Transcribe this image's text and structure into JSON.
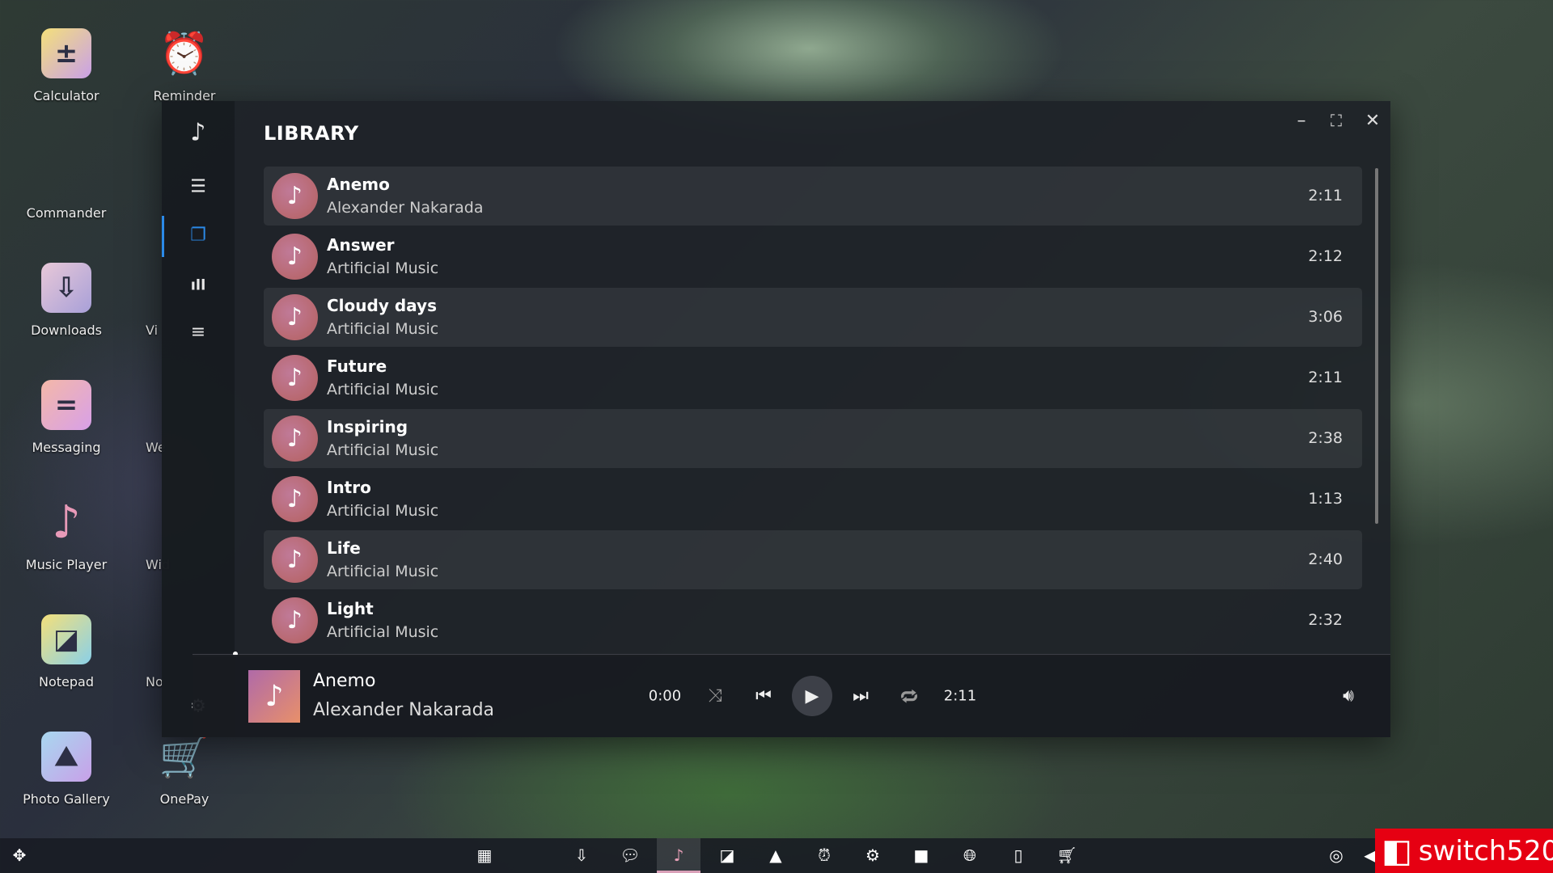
{
  "desktop": {
    "icons": [
      {
        "label": "Calculator",
        "glyph": "±",
        "color": "linear-gradient(135deg,#f4e07a,#c9a0e8)"
      },
      {
        "label": "Commander",
        "glyph": "</>",
        "color": "transparent"
      },
      {
        "label": "Downloads",
        "glyph": "⇩",
        "color": "linear-gradient(135deg,#e8c8d8,#a8a0d8)"
      },
      {
        "label": "Messaging",
        "glyph": "=",
        "color": "linear-gradient(135deg,#f4b8a8,#d8a0e8)"
      },
      {
        "label": "Music Player",
        "glyph": "♪",
        "color": "transparent"
      },
      {
        "label": "Notepad",
        "glyph": "◪",
        "color": "linear-gradient(135deg,#f4e07a,#8ad0e8)"
      },
      {
        "label": "Photo Gallery",
        "glyph": "⛰",
        "color": "linear-gradient(135deg,#a8d8f0,#c8a0e8)"
      }
    ],
    "icons2": [
      {
        "label": "Reminder",
        "glyph": "⏰"
      },
      {
        "label": ""
      },
      {
        "label": "Vi"
      },
      {
        "label": "We"
      },
      {
        "label": "Wid"
      },
      {
        "label": "No"
      },
      {
        "label": "OnePay",
        "glyph": "🛒"
      }
    ]
  },
  "app": {
    "title": "LIBRARY",
    "sidebar": [
      {
        "icon": "music-note-icon"
      },
      {
        "icon": "menu-icon"
      },
      {
        "icon": "library-icon",
        "active": true
      },
      {
        "icon": "equalizer-icon"
      },
      {
        "icon": "playlist-icon"
      },
      {
        "icon": "settings-icon"
      }
    ],
    "accent": "#2b8ae8",
    "tracks": [
      {
        "title": "Anemo",
        "artist": "Alexander Nakarada",
        "duration": "2:11"
      },
      {
        "title": "Answer",
        "artist": "Artificial Music",
        "duration": "2:12"
      },
      {
        "title": "Cloudy days",
        "artist": "Artificial Music",
        "duration": "3:06"
      },
      {
        "title": "Future",
        "artist": "Artificial Music",
        "duration": "2:11"
      },
      {
        "title": "Inspiring",
        "artist": "Artificial Music",
        "duration": "2:38"
      },
      {
        "title": "Intro",
        "artist": "Artificial Music",
        "duration": "1:13"
      },
      {
        "title": "Life",
        "artist": "Artificial Music",
        "duration": "2:40"
      },
      {
        "title": "Light",
        "artist": "Artificial Music",
        "duration": "2:32"
      }
    ],
    "player": {
      "title": "Anemo",
      "artist": "Alexander Nakarada",
      "elapsed": "0:00",
      "total": "2:11",
      "progress": 0
    }
  },
  "taskbar": {
    "icons": [
      "calculator-icon",
      "code-icon",
      "download-icon",
      "message-icon",
      "music-icon",
      "notepad-icon",
      "gallery-icon",
      "alarm-icon",
      "settings-icon",
      "video-icon",
      "globe-icon",
      "widgets-icon",
      "cart-icon"
    ],
    "active": "music-icon"
  },
  "watermark": "switch520"
}
